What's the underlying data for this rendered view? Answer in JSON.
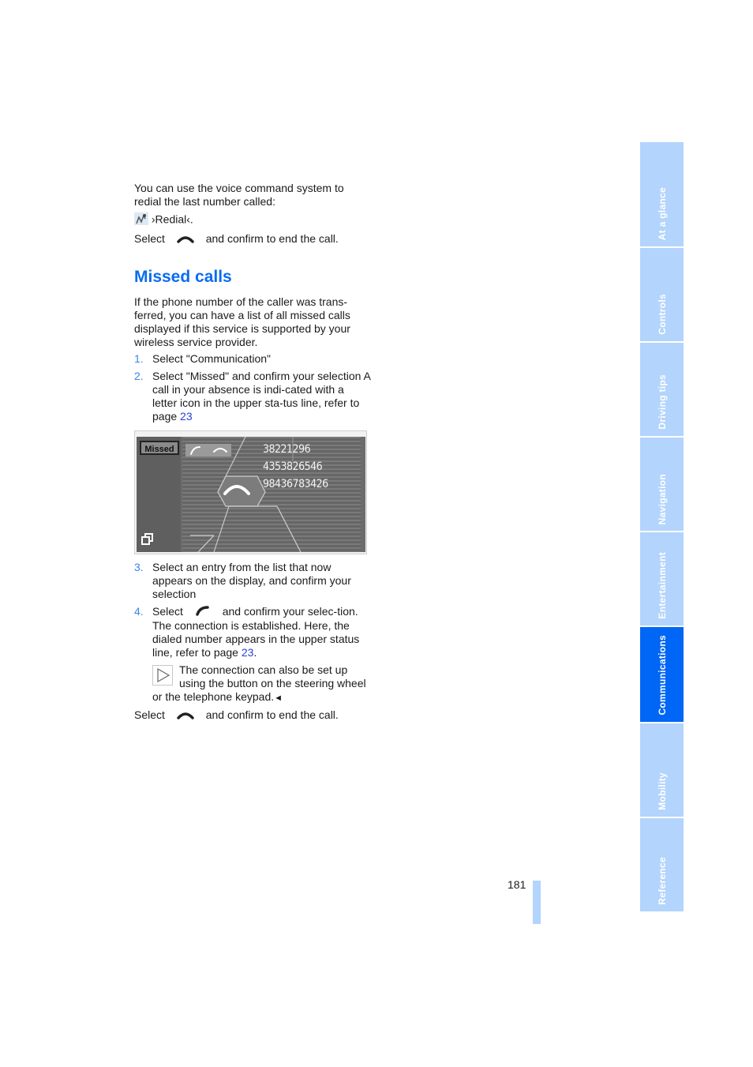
{
  "intro": {
    "text": "You can use the voice command system to redial the last number called:",
    "voice_command": "›Redial‹.",
    "select_label": "Select",
    "end_call_text": "and confirm to end the call."
  },
  "section": {
    "title": "Missed calls",
    "paragraph": "If the phone number of the caller was trans-ferred, you can have a list of all missed calls displayed if this service is supported by your wireless service provider.",
    "steps": [
      {
        "num": "1.",
        "text": "Select \"Communication\""
      },
      {
        "num": "2.",
        "text": "Select \"Missed\" and confirm your selection A call in your absence is indi-cated with a letter icon in the upper sta-tus line, refer to page ",
        "link": "23"
      },
      {
        "num": "3.",
        "text": "Select an entry from the list that now appears on the display, and confirm your selection"
      },
      {
        "num": "4.",
        "select_label": "Select",
        "text": "and confirm your selec-tion.",
        "followup": "The connection is established. Here, the dialed number appears in the upper status line, refer to page ",
        "link": "23",
        "followup_end": "."
      }
    ],
    "note": "The connection can also be set up using the button on the steering wheel or the telephone keypad.",
    "note_end": "◄",
    "final_select_label": "Select",
    "final_text": "and confirm to end the call."
  },
  "screen": {
    "tab_label": "Missed",
    "numbers": [
      "38221296",
      "4353826546",
      "98436783426"
    ]
  },
  "sidebar": {
    "tabs": [
      {
        "label": "At a glance",
        "active": false
      },
      {
        "label": "Controls",
        "active": false
      },
      {
        "label": "Driving tips",
        "active": false
      },
      {
        "label": "Navigation",
        "active": false
      },
      {
        "label": "Entertainment",
        "active": false
      },
      {
        "label": "Communications",
        "active": true
      },
      {
        "label": "Mobility",
        "active": false
      },
      {
        "label": "Reference",
        "active": false
      }
    ]
  },
  "footer": {
    "page_number": "181"
  },
  "colors": {
    "accent": "#0066f5",
    "tab_inactive": "#b3d4fc",
    "heading": "#0a6cf0"
  }
}
